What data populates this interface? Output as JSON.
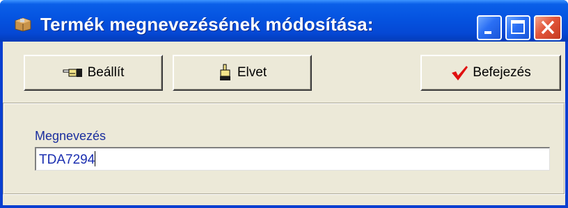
{
  "window": {
    "title": "Termék megnevezésének módosítása:",
    "controls": [
      "minimize",
      "maximize",
      "close"
    ]
  },
  "toolbar": {
    "set_label": "Beállít",
    "set_icon": "pointing-hand-icon",
    "discard_label": "Elvet",
    "discard_icon": "raised-hand-icon",
    "finish_label": "Befejezés",
    "finish_icon": "checkmark-icon"
  },
  "form": {
    "name_label": "Megnevezés",
    "name_value": "TDA7294"
  },
  "colors": {
    "titlebar": "#0553e0",
    "client": "#ece9d8",
    "label_text": "#1a2e9e",
    "checkmark": "#e01010"
  }
}
